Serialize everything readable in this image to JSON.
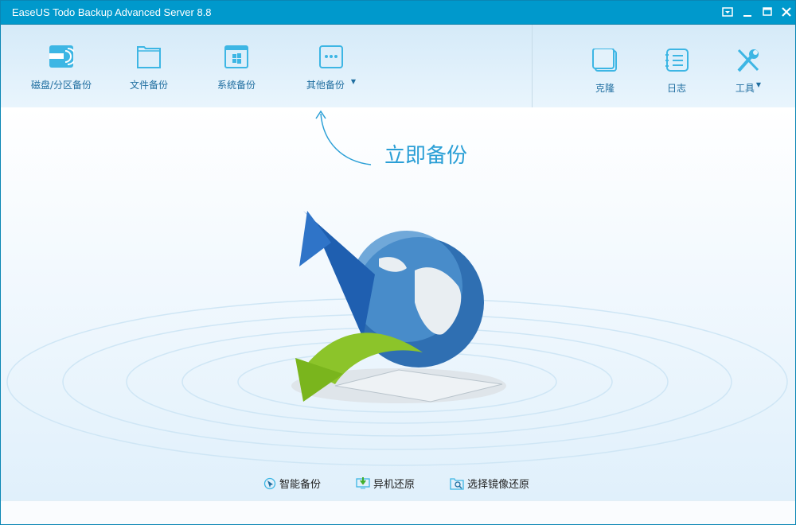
{
  "window": {
    "title": "EaseUS Todo Backup Advanced Server 8.8"
  },
  "toolbar": {
    "left": [
      {
        "label": "磁盘/分区备份",
        "icon": "disk-icon"
      },
      {
        "label": "文件备份",
        "icon": "folder-icon"
      },
      {
        "label": "系统备份",
        "icon": "windows-icon"
      },
      {
        "label": "其他备份",
        "icon": "more-icon"
      }
    ],
    "right": [
      {
        "label": "克隆",
        "icon": "clone-icon"
      },
      {
        "label": "日志",
        "icon": "log-icon"
      },
      {
        "label": "工具",
        "icon": "tools-icon"
      }
    ]
  },
  "main": {
    "hint": "立即备份"
  },
  "links": [
    {
      "label": "智能备份",
      "icon": "smart-backup-icon"
    },
    {
      "label": "异机还原",
      "icon": "restore-icon"
    },
    {
      "label": "选择镜像还原",
      "icon": "image-search-icon"
    }
  ],
  "colors": {
    "titlebar": "#0099cc",
    "accent": "#2a9fd6"
  }
}
